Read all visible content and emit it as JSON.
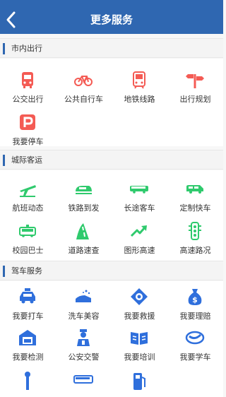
{
  "header": {
    "title": "更多服务",
    "back_icon": "back-arrow-icon"
  },
  "colors": {
    "brand": "#2f67b1",
    "red": "#f45b54",
    "green": "#2fca6d",
    "blue": "#2f6fdc"
  },
  "sections": [
    {
      "title": "市内出行",
      "items": [
        {
          "label": "公交出行",
          "icon": "bus-icon"
        },
        {
          "label": "公共自行车",
          "icon": "bicycle-icon"
        },
        {
          "label": "地铁线路",
          "icon": "subway-icon"
        },
        {
          "label": "出行规划",
          "icon": "route-sign-icon"
        },
        {
          "label": "我要停车",
          "icon": "parking-icon"
        }
      ]
    },
    {
      "title": "城际客运",
      "items": [
        {
          "label": "航班动态",
          "icon": "airplane-icon"
        },
        {
          "label": "铁路到发",
          "icon": "train-icon"
        },
        {
          "label": "长途客车",
          "icon": "coach-icon"
        },
        {
          "label": "定制快车",
          "icon": "van-icon"
        },
        {
          "label": "校园巴士",
          "icon": "campus-bus-icon"
        },
        {
          "label": "道路速查",
          "icon": "road-icon"
        },
        {
          "label": "图形高速",
          "icon": "trend-icon"
        },
        {
          "label": "高速路况",
          "icon": "traffic-light-icon"
        }
      ]
    },
    {
      "title": "驾车服务",
      "items": [
        {
          "label": "我要打车",
          "icon": "taxi-icon"
        },
        {
          "label": "洗车美容",
          "icon": "car-wash-icon"
        },
        {
          "label": "我要救援",
          "icon": "rescue-icon"
        },
        {
          "label": "我要理赔",
          "icon": "money-bag-icon"
        },
        {
          "label": "我要检测",
          "icon": "garage-icon"
        },
        {
          "label": "公安交警",
          "icon": "police-icon"
        },
        {
          "label": "我要培训",
          "icon": "book-icon"
        },
        {
          "label": "我要学车",
          "icon": "steering-icon"
        },
        {
          "label": "",
          "icon": "wrench-icon"
        },
        {
          "label": "",
          "icon": "bus-blue-icon"
        },
        {
          "label": "",
          "icon": "fuel-icon"
        }
      ]
    }
  ]
}
